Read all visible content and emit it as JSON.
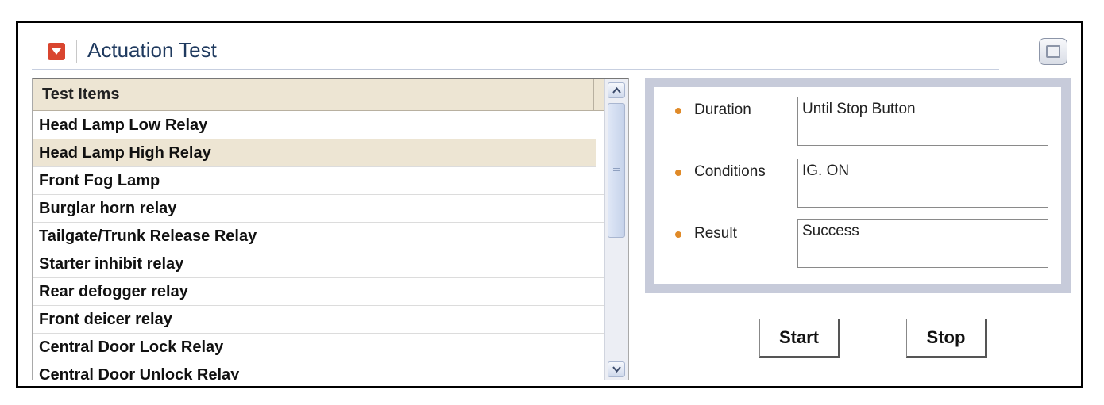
{
  "panel": {
    "title": "Actuation Test"
  },
  "test_items": {
    "header": "Test Items",
    "items": [
      "Head Lamp Low Relay",
      "Head Lamp High Relay",
      "Front Fog Lamp",
      "Burglar horn relay",
      "Tailgate/Trunk Release Relay",
      "Starter inhibit relay",
      "Rear defogger relay",
      "Front deicer relay",
      "Central Door Lock Relay",
      "Central Door Unlock Relay"
    ],
    "selected": "Head Lamp High Relay"
  },
  "info": {
    "duration_label": "Duration",
    "duration_value": "Until Stop Button",
    "conditions_label": "Conditions",
    "conditions_value": "IG. ON",
    "result_label": "Result",
    "result_value": "Success"
  },
  "buttons": {
    "start": "Start",
    "stop": "Stop"
  },
  "colors": {
    "title": "#1f3a5f",
    "header_icon": "#d9452f",
    "selected_row": "#ede5d3",
    "bullet": "#e08a28",
    "info_panel_border": "#c7cbda"
  },
  "icons": {
    "collapse": "chevron-down-icon",
    "maximize": "maximize-icon",
    "scroll_up": "arrow-up-icon",
    "scroll_down": "arrow-down-icon"
  }
}
